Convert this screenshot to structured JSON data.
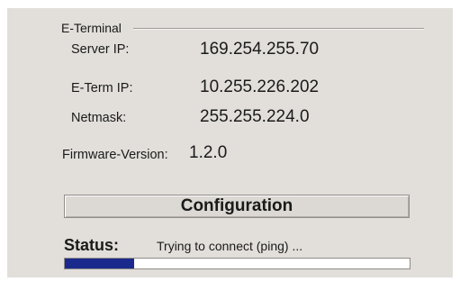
{
  "group": {
    "title": "E-Terminal"
  },
  "fields": {
    "server_ip": {
      "label": "Server IP:",
      "value": "169.254.255.70"
    },
    "eterm_ip": {
      "label": "E-Term IP:",
      "value": "10.255.226.202"
    },
    "netmask": {
      "label": "Netmask:",
      "value": "255.255.224.0"
    },
    "firmware": {
      "label": "Firmware-Version:",
      "value": "1.2.0"
    }
  },
  "configuration_button": {
    "label": "Configuration"
  },
  "status": {
    "label": "Status:",
    "text": "Trying to connect (ping) ...",
    "progress_fraction": 0.2,
    "progress_color": "#1a2a8c"
  },
  "colors": {
    "panel_background": "#e2dfdb"
  }
}
